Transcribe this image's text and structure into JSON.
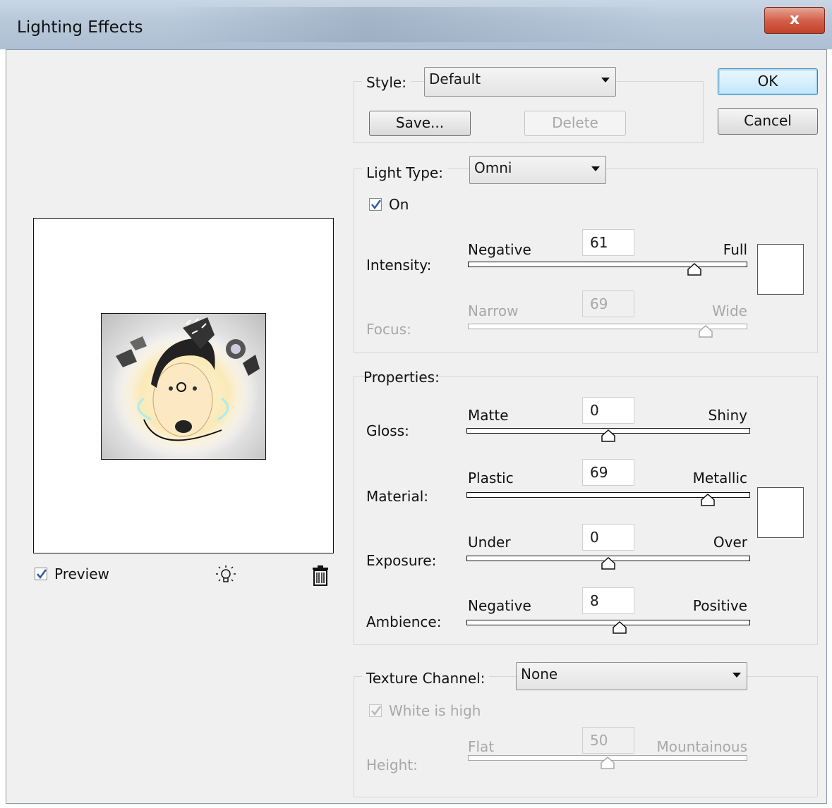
{
  "window": {
    "title": "Lighting Effects",
    "close_glyph": "x"
  },
  "style": {
    "label": "Style:",
    "selected": "Default",
    "save_label": "Save...",
    "delete_label": "Delete"
  },
  "buttons": {
    "ok": "OK",
    "cancel": "Cancel"
  },
  "light_type": {
    "label": "Light Type:",
    "selected": "Omni",
    "on_label": "On",
    "on_checked": true,
    "intensity": {
      "label": "Intensity:",
      "min_label": "Negative",
      "max_label": "Full",
      "value": "61",
      "slider_fraction": 0.81
    },
    "focus": {
      "label": "Focus:",
      "min_label": "Narrow",
      "max_label": "Wide",
      "value": "69",
      "slider_fraction": 0.85,
      "disabled": true
    },
    "swatch_color": "#ffffff"
  },
  "properties": {
    "label": "Properties:",
    "gloss": {
      "label": "Gloss:",
      "min_label": "Matte",
      "max_label": "Shiny",
      "value": "0",
      "slider_fraction": 0.5
    },
    "material": {
      "label": "Material:",
      "min_label": "Plastic",
      "max_label": "Metallic",
      "value": "69",
      "slider_fraction": 0.85
    },
    "exposure": {
      "label": "Exposure:",
      "min_label": "Under",
      "max_label": "Over",
      "value": "0",
      "slider_fraction": 0.5
    },
    "ambience": {
      "label": "Ambience:",
      "min_label": "Negative",
      "max_label": "Positive",
      "value": "8",
      "slider_fraction": 0.54
    },
    "swatch_color": "#ffffff"
  },
  "texture": {
    "label": "Texture Channel:",
    "selected": "None",
    "white_is_high_label": "White is high",
    "white_is_high_checked": true,
    "height": {
      "label": "Height:",
      "min_label": "Flat",
      "max_label": "Mountainous",
      "value": "50",
      "slider_fraction": 0.5,
      "disabled": true
    }
  },
  "preview": {
    "label": "Preview",
    "checked": true,
    "light_icon": "light-bulb-icon",
    "trash_icon": "trash-icon"
  }
}
